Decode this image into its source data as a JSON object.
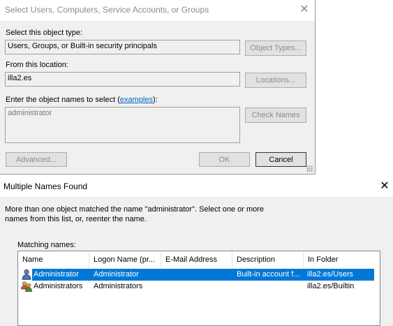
{
  "select_dialog": {
    "title": "Select Users, Computers, Service Accounts, or Groups",
    "object_type_label": "Select this object type:",
    "object_type_value": "Users, Groups, or Built-in security principals",
    "object_types_button": "Object Types...",
    "location_label": "From this location:",
    "location_value": "illa2.es",
    "locations_button": "Locations...",
    "names_label_prefix": "Enter the object names to select (",
    "names_label_link": "examples",
    "names_label_suffix": "):",
    "names_value": "administrator",
    "check_names_button": "Check Names",
    "advanced_button": "Advanced...",
    "ok_button": "OK",
    "cancel_button": "Cancel"
  },
  "multiple_names_dialog": {
    "title": "Multiple Names Found",
    "message": "More than one object matched the name \"administrator\". Select one or more names from this list, or, reenter the name.",
    "matching_label": "Matching names:",
    "columns": [
      "Name",
      "Logon Name (pr...",
      "E-Mail Address",
      "Description",
      "In Folder"
    ],
    "rows": [
      {
        "icon": "user-icon",
        "name": "Administrator",
        "logon": "Administrator",
        "email": "",
        "description": "Built-in account f...",
        "folder": "illa2.es/Users",
        "selected": true
      },
      {
        "icon": "group-icon",
        "name": "Administrators",
        "logon": "Administrators",
        "email": "",
        "description": "",
        "folder": "illa2.es/Builtin",
        "selected": false
      }
    ]
  },
  "colors": {
    "selection": "#0078d7",
    "dialog_bg": "#f0f0f0",
    "link": "#0066cc"
  }
}
